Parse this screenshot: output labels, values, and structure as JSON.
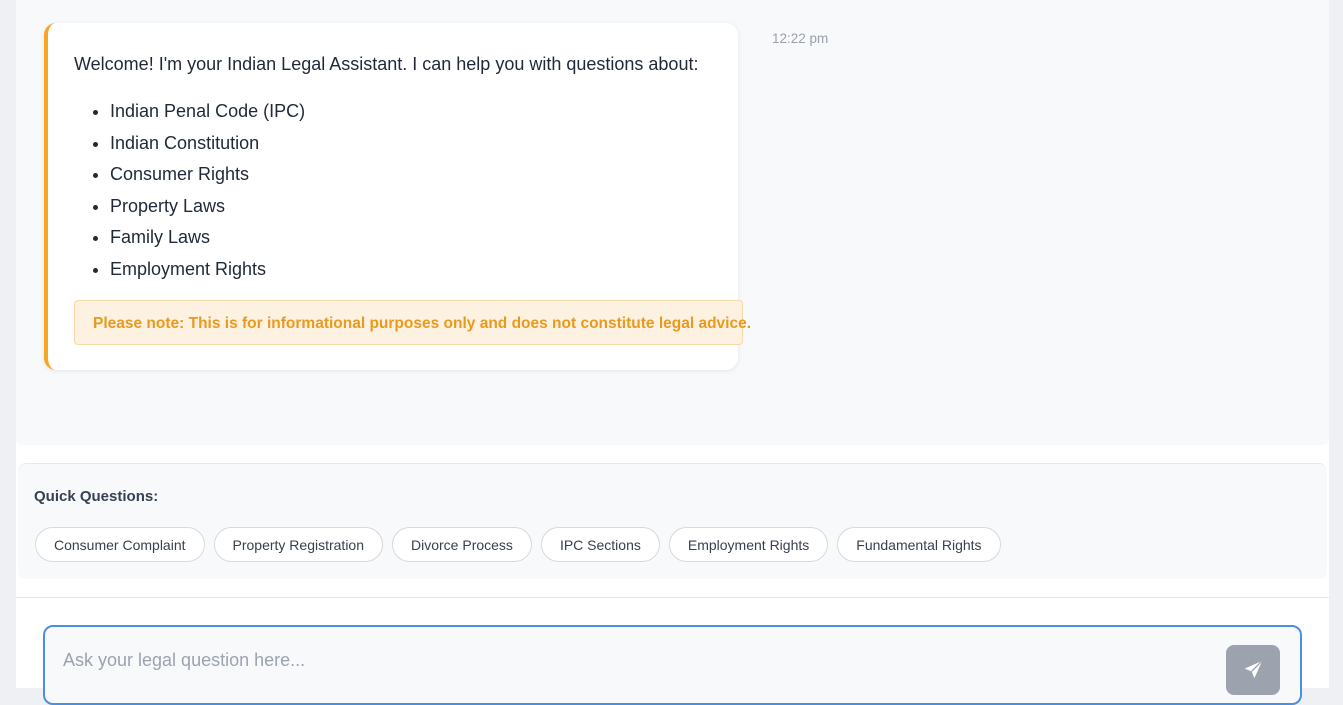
{
  "welcome_message": {
    "intro": "Welcome! I'm your Indian Legal Assistant. I can help you with questions about:",
    "topics": [
      "Indian Penal Code (IPC)",
      "Indian Constitution",
      "Consumer Rights",
      "Property Laws",
      "Family Laws",
      "Employment Rights"
    ],
    "disclaimer": "Please note: This is for informational purposes only and does not constitute legal advice.",
    "timestamp": "12:22 pm"
  },
  "quick_questions": {
    "title": "Quick Questions:",
    "chips": [
      "Consumer Complaint",
      "Property Registration",
      "Divorce Process",
      "IPC Sections",
      "Employment Rights",
      "Fundamental Rights"
    ]
  },
  "composer": {
    "placeholder": "Ask your legal question here...",
    "value": "",
    "send_icon": "send-icon"
  },
  "colors": {
    "accent_border": "#f5a623",
    "disclaimer_text": "#e89a1c",
    "input_focus_border": "#4a90e2",
    "send_button_bg": "#9ca3af"
  }
}
